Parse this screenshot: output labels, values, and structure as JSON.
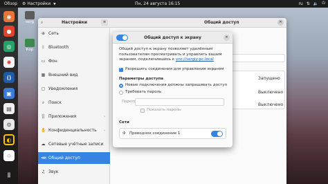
{
  "topbar": {
    "activities": "Обзор",
    "app_name": "Настройки",
    "clock": "Пн, 24 августа  16:15",
    "language": "ru"
  },
  "desktop": {
    "icon1_label": "serg",
    "icon2_label": "Кор"
  },
  "settings": {
    "sidebar_title": "Настройки",
    "content_title": "Общий доступ",
    "sidebar": [
      {
        "icon": "network-icon",
        "label": "Сеть"
      },
      {
        "icon": "bluetooth-icon",
        "label": "Bluetooth"
      },
      {
        "icon": "background-icon",
        "label": "Фон"
      },
      {
        "icon": "appearance-icon",
        "label": "Внешний вид"
      },
      {
        "icon": "notifications-icon",
        "label": "Уведомления"
      },
      {
        "icon": "search-icon",
        "label": "Поиск"
      },
      {
        "icon": "applications-icon",
        "label": "Приложения"
      },
      {
        "icon": "privacy-icon",
        "label": "Конфиденциальность"
      },
      {
        "icon": "online-accounts-icon",
        "label": "Сетевые учётные записи"
      },
      {
        "icon": "sharing-icon",
        "label": "Общий доступ"
      },
      {
        "icon": "sound-icon",
        "label": "Звук"
      }
    ],
    "rows": {
      "row1_status": "Запущено",
      "row2_status": "Выключено",
      "row3_status": "Выключено"
    }
  },
  "dialog": {
    "title": "Общий доступ к экрану",
    "description": "Общий доступ к экрану позволяет удалённым пользователям просматривать и управлять вашим экраном, подключившись к",
    "link": "vnc://sergiy-pc.local",
    "allow_control_label": "Разрешить соединения для управления экраном",
    "access_params_title": "Параметры доступа",
    "option_confirm_label": "Новые подключения должны запрашивать доступ",
    "option_password_label": "Требовать пароль",
    "password_label": "Пароль:",
    "show_password_label": "Показать пароль",
    "networks_title": "Сети",
    "network_label": "Проводное соединение 1"
  },
  "colors": {
    "accent": "#3584e4",
    "topbar": "#1d1d1d",
    "link": "#1a5fb4"
  }
}
